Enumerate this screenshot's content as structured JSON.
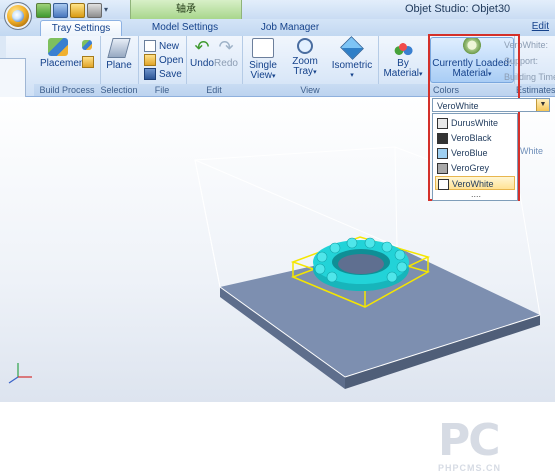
{
  "titlebar": {
    "context_tab": "轴承",
    "app_title": "Objet Studio: Objet30"
  },
  "tabs": [
    {
      "label": "Tray Settings",
      "active": true
    },
    {
      "label": "Model Settings",
      "active": false
    },
    {
      "label": "Job Manager",
      "active": false
    }
  ],
  "edit_label": "Edit",
  "ribbon": {
    "placement": "Placement",
    "plane": "Plane",
    "new": "New",
    "open": "Open",
    "save": "Save",
    "undo": "Undo",
    "redo": "Redo",
    "single_view": "Single",
    "single_view_2": "View",
    "zoom_tray": "Zoom",
    "zoom_tray_2": "Tray",
    "isometric": "Isometric",
    "by_material": "By",
    "by_material_2": "Material",
    "currently_loaded": "Currently Loaded:",
    "currently_loaded_2": "Material",
    "groups": {
      "build_process": "Build Process",
      "selection": "Selection",
      "file": "File",
      "edit": "Edit",
      "view": "View",
      "colors": "Colors",
      "estimates": "Estimates a"
    },
    "estimates": {
      "verowhite": "VeroWhite:",
      "support": "Support:",
      "building_time": "Building Time:"
    }
  },
  "material_dropdown": {
    "selected": "VeroWhite",
    "items": [
      {
        "label": "DurusWhite",
        "swatch": "#e8e8e8"
      },
      {
        "label": "VeroBlack",
        "swatch": "#333333"
      },
      {
        "label": "VeroBlue",
        "swatch": "#9fd0f2"
      },
      {
        "label": "VeroGrey",
        "swatch": "#a8a8a8"
      },
      {
        "label": "VeroWhite",
        "swatch": "#ffffff"
      }
    ],
    "more": "....",
    "side_label": "White"
  },
  "colors": {
    "accent_red": "#d4302a",
    "model_cyan": "#22d3d8",
    "tray": "#7d8fb0",
    "selection_yellow": "#f5e600"
  },
  "watermark": {
    "big": "PC",
    "small": "PHPCMS.CN"
  }
}
